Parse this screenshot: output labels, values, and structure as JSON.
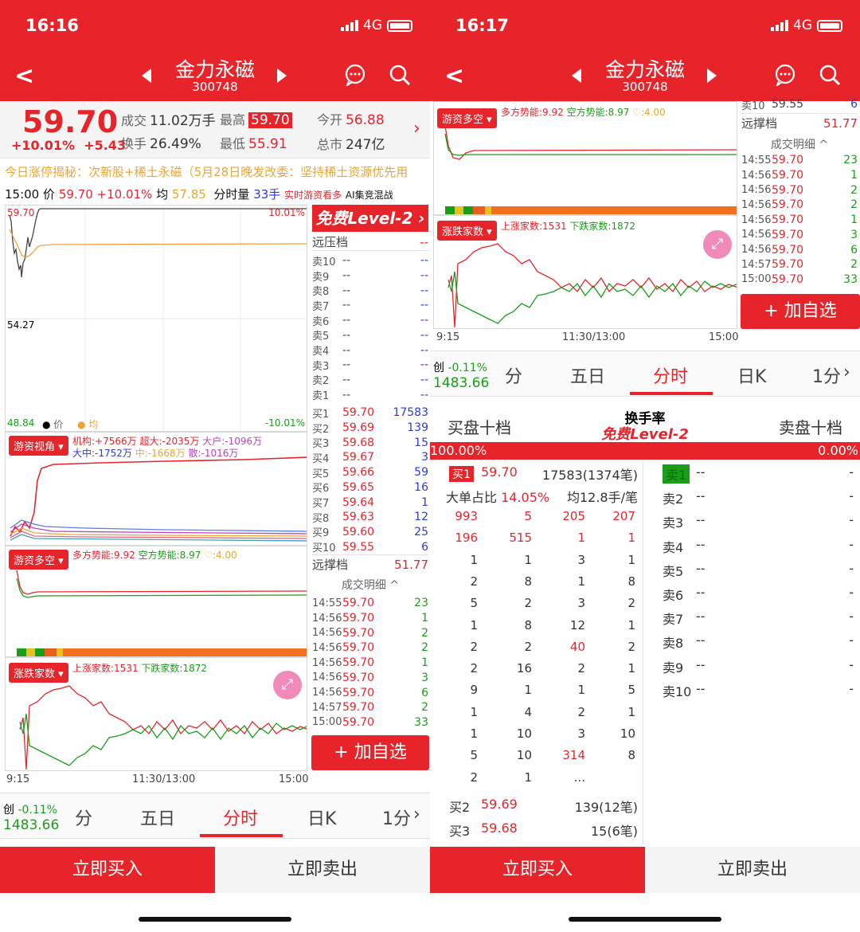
{
  "left": {
    "status": {
      "time": "16:16",
      "network": "4G"
    },
    "nav": {
      "title": "金力永磁",
      "code": "300748"
    },
    "quote": {
      "price": "59.70",
      "change_pct": "+10.01%",
      "change": "+5.43",
      "vol_label": "成交",
      "vol": "11.02万手",
      "high_label": "最高",
      "high": "59.70",
      "open_label": "今开",
      "open": "56.88",
      "turn_label": "换手",
      "turn": "26.49%",
      "low_label": "最低",
      "low": "55.91",
      "cap_label": "总市",
      "cap": "247亿"
    },
    "ticker": "今日涨停揭秘：次新股+稀土永磁（5月28日晚发改委：坚持稀土资源优先用",
    "info": {
      "time": "15:00",
      "price_label": "价",
      "price": "59.70",
      "pct": "+10.01%",
      "avg_label": "均",
      "avg": "57.85",
      "vol_label": "分时量",
      "vol": "33手",
      "live": "实时游资看多",
      "ai": "AI集竞混战"
    },
    "chart": {
      "top_left": "59.70",
      "top_right": "10.01%",
      "mid": "54.27",
      "bot_left": "48.84",
      "bot_right": "-10.01%",
      "legend_price": "价",
      "legend_avg": "均"
    },
    "capital": {
      "tag": "游资视角",
      "line1_a": "机构:+7566万",
      "line1_b": "超大:-2035万",
      "line1_c": "大户:-1096万",
      "line2_a": "大中:-1752万",
      "line2_b": "中:-1668万",
      "line2_c": "散:-1016万"
    },
    "power": {
      "tag": "游资多空",
      "long": "多方势能:9.92",
      "short": "空方势能:8.97",
      "heart": "♡:4.00"
    },
    "updown": {
      "tag": "涨跌家数",
      "up": "上涨家数:1531",
      "down": "下跌家数:1872"
    },
    "axis": {
      "start": "9:15",
      "mid": "11:30/13:00",
      "end": "15:00"
    },
    "level2": "免费Level-2 ›",
    "orderbook": {
      "far_pressure": "远压档",
      "far_pressure_val": "--",
      "sells": [
        [
          "卖10",
          "--",
          "--"
        ],
        [
          "卖9",
          "--",
          "--"
        ],
        [
          "卖8",
          "--",
          "--"
        ],
        [
          "卖7",
          "--",
          "--"
        ],
        [
          "卖6",
          "--",
          "--"
        ],
        [
          "卖5",
          "--",
          "--"
        ],
        [
          "卖4",
          "--",
          "--"
        ],
        [
          "卖3",
          "--",
          "--"
        ],
        [
          "卖2",
          "--",
          "--"
        ],
        [
          "卖1",
          "--",
          "--"
        ]
      ],
      "buys": [
        [
          "买1",
          "59.70",
          "17583"
        ],
        [
          "买2",
          "59.69",
          "139"
        ],
        [
          "买3",
          "59.68",
          "15"
        ],
        [
          "买4",
          "59.67",
          "3"
        ],
        [
          "买5",
          "59.66",
          "59"
        ],
        [
          "买6",
          "59.65",
          "16"
        ],
        [
          "买7",
          "59.64",
          "1"
        ],
        [
          "买8",
          "59.63",
          "12"
        ],
        [
          "买9",
          "59.60",
          "25"
        ],
        [
          "买10",
          "59.55",
          "6"
        ]
      ],
      "far_support": "远撑档",
      "far_support_val": "51.77",
      "detail": "成交明细 ^",
      "trades": [
        [
          "14:55",
          "59.70",
          "23"
        ],
        [
          "14:56",
          "59.70",
          "1"
        ],
        [
          "14:56",
          "59.70",
          "2"
        ],
        [
          "14:56",
          "59.70",
          "2"
        ],
        [
          "14:56",
          "59.70",
          "1"
        ],
        [
          "14:56",
          "59.70",
          "3"
        ],
        [
          "14:56",
          "59.70",
          "6"
        ],
        [
          "14:57",
          "59.70",
          "2"
        ],
        [
          "15:00",
          "59.70",
          "33"
        ]
      ]
    },
    "add": "+ 加自选",
    "index": {
      "name": "创",
      "pct": "-0.11%",
      "value": "1483.66"
    },
    "tabs": [
      "分",
      "五日",
      "分时",
      "日K",
      "1分"
    ],
    "buy": "立即买入",
    "sell": "立即卖出"
  },
  "right": {
    "status": {
      "time": "16:17",
      "network": "4G"
    },
    "nav": {
      "title": "金力永磁",
      "code": "300748"
    },
    "power": {
      "tag": "游资多空",
      "long": "多方势能:9.92",
      "short": "空方势能:8.97",
      "heart": "♡:4.00"
    },
    "updown": {
      "tag": "涨跌家数",
      "up": "上涨家数:1531",
      "down": "下跌家数:1872"
    },
    "axis": {
      "start": "9:15",
      "mid": "11:30/13:00",
      "end": "15:00"
    },
    "ob_top": {
      "sell10": "卖10",
      "sell10_p": "59.55",
      "sell10_n": "6",
      "far_support": "远撑档",
      "far_support_val": "51.77",
      "detail": "成交明细 ^"
    },
    "trades": [
      [
        "14:55",
        "59.70",
        "23"
      ],
      [
        "14:56",
        "59.70",
        "1"
      ],
      [
        "14:56",
        "59.70",
        "2"
      ],
      [
        "14:56",
        "59.70",
        "2"
      ],
      [
        "14:56",
        "59.70",
        "1"
      ],
      [
        "14:56",
        "59.70",
        "3"
      ],
      [
        "14:56",
        "59.70",
        "6"
      ],
      [
        "14:57",
        "59.70",
        "2"
      ],
      [
        "15:00",
        "59.70",
        "33"
      ]
    ],
    "add": "+ 加自选",
    "index": {
      "name": "创",
      "pct": "-0.11%",
      "value": "1483.66"
    },
    "tabs": [
      "分",
      "五日",
      "分时",
      "日K",
      "1分"
    ],
    "ten": {
      "buy_title": "买盘十档",
      "center_title": "换手率",
      "center_sub": "免费Level-2",
      "sell_title": "卖盘十档",
      "buy_pct": "100.00%",
      "sell_pct": "0.00%",
      "buy1_label": "买1",
      "buy1_price": "59.70",
      "buy1_qty": "17583(1374笔)",
      "big_label": "大单占比",
      "big_val": "14.05%",
      "avg": "均12.8手/笔",
      "grid": [
        [
          "993",
          "5",
          "205",
          "207"
        ],
        [
          "196",
          "515",
          "1",
          "1"
        ],
        [
          "1",
          "1",
          "3",
          "1"
        ],
        [
          "2",
          "8",
          "1",
          "8"
        ],
        [
          "5",
          "2",
          "3",
          "2"
        ],
        [
          "1",
          "8",
          "12",
          "1"
        ],
        [
          "2",
          "2",
          "40",
          "2"
        ],
        [
          "2",
          "16",
          "2",
          "1"
        ],
        [
          "9",
          "1",
          "1",
          "5"
        ],
        [
          "1",
          "4",
          "2",
          "1"
        ],
        [
          "1",
          "10",
          "3",
          "10"
        ],
        [
          "5",
          "10",
          "314",
          "8"
        ],
        [
          "2",
          "1",
          "...",
          ""
        ]
      ],
      "buy2": [
        "买2",
        "59.69",
        "139(12笔)"
      ],
      "buy3": [
        "买3",
        "59.68",
        "15(6笔)"
      ],
      "sells": [
        [
          "卖1",
          "--",
          "-"
        ],
        [
          "卖2",
          "--",
          "-"
        ],
        [
          "卖3",
          "--",
          "-"
        ],
        [
          "卖4",
          "--",
          "-"
        ],
        [
          "卖5",
          "--",
          "-"
        ],
        [
          "卖6",
          "--",
          "-"
        ],
        [
          "卖7",
          "--",
          "-"
        ],
        [
          "卖8",
          "--",
          "-"
        ],
        [
          "卖9",
          "--",
          "-"
        ],
        [
          "卖10",
          "--",
          "-"
        ]
      ]
    },
    "buy": "立即买入",
    "sell": "立即卖出"
  }
}
